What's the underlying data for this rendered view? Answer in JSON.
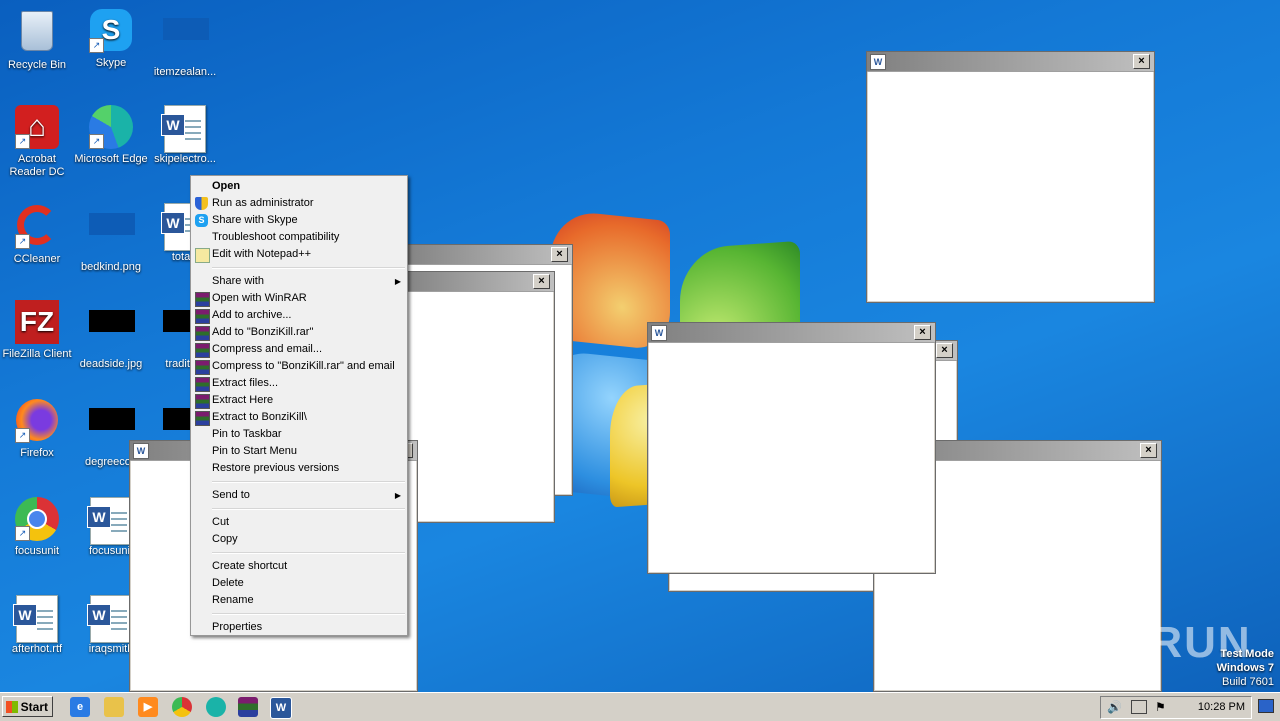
{
  "desktop_icons": [
    {
      "label": "Recycle Bin"
    },
    {
      "label": "Skype"
    },
    {
      "label": "itemzealan..."
    },
    {
      "label": "Acrobat Reader DC"
    },
    {
      "label": "Microsoft Edge"
    },
    {
      "label": "skipelectro..."
    },
    {
      "label": "CCleaner"
    },
    {
      "label": "bedkind.png"
    },
    {
      "label": "totalk"
    },
    {
      "label": "FileZilla Client"
    },
    {
      "label": "deadside.jpg"
    },
    {
      "label": "tradition"
    },
    {
      "label": "Firefox"
    },
    {
      "label": "degreecou"
    },
    {
      "label": "Google Chrome"
    },
    {
      "label": "focusunit"
    },
    {
      "label": "afterhot.rtf"
    },
    {
      "label": "iraqsmith"
    }
  ],
  "context_menu": {
    "group1": [
      "Open",
      "Run as administrator",
      "Share with Skype",
      "Troubleshoot compatibility",
      "Edit with Notepad++"
    ],
    "group2": [
      "Share with",
      "Open with WinRAR",
      "Add to archive...",
      "Add to \"BonziKill.rar\"",
      "Compress and email...",
      "Compress to \"BonziKill.rar\" and email",
      "Extract files...",
      "Extract Here",
      "Extract to BonziKill\\",
      "Pin to Taskbar",
      "Pin to Start Menu",
      "Restore previous versions"
    ],
    "group3": [
      "Send to"
    ],
    "group4": [
      "Cut",
      "Copy"
    ],
    "group5": [
      "Create shortcut",
      "Delete",
      "Rename"
    ],
    "group6": [
      "Properties"
    ]
  },
  "taskbar": {
    "start_label": "Start",
    "clock": "10:28 PM"
  },
  "watermark": {
    "line1": "Test Mode",
    "line2": "Windows 7",
    "line3": "Build 7601",
    "brand": "ANY RUN"
  }
}
